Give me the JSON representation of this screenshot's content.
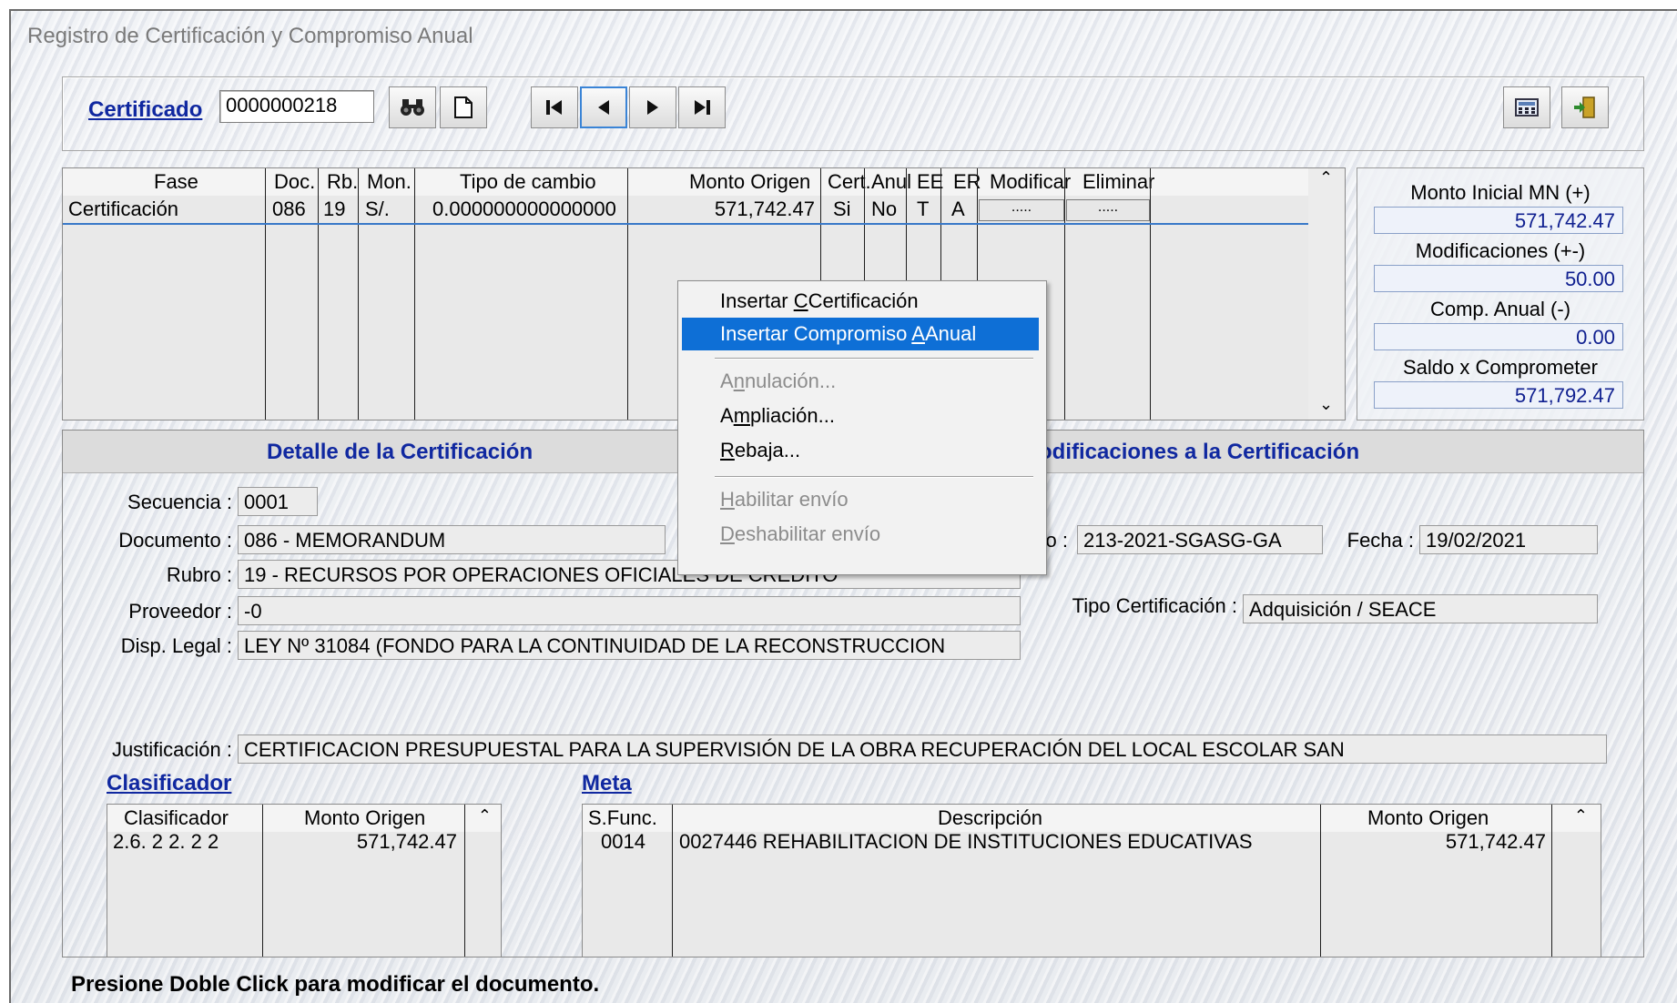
{
  "window": {
    "title": "Registro de Certificación y Compromiso Anual"
  },
  "toolbar": {
    "cert_link": "Certificado",
    "cert_number": "0000000218",
    "search_icon": "binoculars-icon",
    "new_icon": "new-document-icon",
    "first_icon": "first-record-icon",
    "prev_icon": "previous-record-icon",
    "next_icon": "next-record-icon",
    "last_icon": "last-record-icon",
    "calc_icon": "calculator-icon",
    "exit_icon": "exit-door-icon"
  },
  "phases": {
    "headers": [
      "Fase",
      "Doc.",
      "Rb.",
      "Mon.",
      "Tipo de cambio",
      "Monto Origen",
      "Cert.",
      "Anul",
      "EE",
      "ER",
      "Modificar",
      "Eliminar"
    ],
    "row": {
      "fase": "Certificación",
      "doc": "086",
      "rb": "19",
      "mon": "S/.",
      "tipo_cambio": "0.000000000000000",
      "monto": "571,742.47",
      "cert": "Si",
      "anul": "No",
      "ee": "T",
      "er": "A",
      "modificar": ".....",
      "eliminar": "....."
    }
  },
  "totals": {
    "monto_inicial_label": "Monto Inicial MN (+)",
    "monto_inicial": "571,742.47",
    "modificaciones_label": "Modificaciones (+-)",
    "modificaciones": "50.00",
    "comp_anual_label": "Comp. Anual (-)",
    "comp_anual": "0.00",
    "saldo_label": "Saldo x Comprometer",
    "saldo": "571,792.47"
  },
  "detail": {
    "title_left": "Detalle de la Certificación",
    "title_right": "odificaciones a la Certificación",
    "secuencia_label": "Secuencia :",
    "secuencia": "0001",
    "documento_label": "Documento :",
    "documento": "086 - MEMORANDUM",
    "numero_label": "o :",
    "numero": "213-2021-SGASG-GA",
    "fecha_label": "Fecha :",
    "fecha": "19/02/2021",
    "rubro_label": "Rubro :",
    "rubro": "19 - RECURSOS POR OPERACIONES OFICIALES DE CREDITO",
    "proveedor_label": "Proveedor :",
    "proveedor": "-0",
    "tipo_cert_label": "Tipo Certificación :",
    "tipo_cert": "Adquisición / SEACE",
    "disp_legal_label": "Disp. Legal :",
    "disp_legal": "LEY Nº 31084 (FONDO PARA LA CONTINUIDAD DE LA RECONSTRUCCION",
    "justificacion_label": "Justificación :",
    "justificacion": "CERTIFICACION PRESUPUESTAL PARA LA SUPERVISIÓN DE LA OBRA RECUPERACIÓN DEL LOCAL ESCOLAR SAN"
  },
  "clasificador": {
    "link": "Clasificador",
    "headers": [
      "Clasificador",
      "Monto Origen"
    ],
    "row": {
      "codigo": "2.6. 2 2. 2 2",
      "monto": "571,742.47"
    }
  },
  "meta": {
    "link": "Meta",
    "headers": [
      "S.Func.",
      "Descripción",
      "Monto Origen"
    ],
    "row": {
      "sfunc": "0014",
      "descripcion": "0027446  REHABILITACION DE INSTITUCIONES EDUCATIVAS",
      "monto": "571,742.47"
    }
  },
  "context_menu": {
    "insertar_cert": "Certificación",
    "insertar_compromiso": "Anual",
    "anulacion": "nulación...",
    "ampliacion": "pliación...",
    "rebaja": "ebaja...",
    "habilitar": "abilitar envío",
    "deshabilitar": "eshabilitar envío"
  },
  "status": {
    "text": "Presione Doble Click para modificar el documento."
  }
}
